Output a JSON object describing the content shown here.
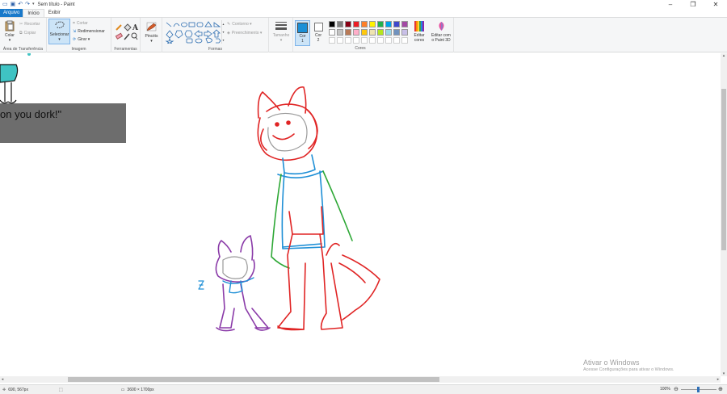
{
  "window": {
    "title": "Sem título - Paint",
    "qa_icons": [
      "paint-app-icon",
      "save-icon",
      "undo-icon",
      "redo-icon",
      "customize-icon"
    ]
  },
  "tabs": [
    {
      "label": "Arquivo"
    },
    {
      "label": "Início"
    },
    {
      "label": "Exibir"
    }
  ],
  "ribbon": {
    "clipboard": {
      "label": "Área de Transferência",
      "paste": "Colar",
      "cut": "Recortar",
      "copy": "Copiar"
    },
    "image": {
      "label": "Imagem",
      "select": "Selecionar",
      "crop": "Cortar",
      "resize": "Redimensionar",
      "rotate": "Girar ▾"
    },
    "tools": {
      "label": "Ferramentas"
    },
    "brushes": {
      "label": "Pincéis"
    },
    "shapes": {
      "label": "Formas",
      "outline": "Contorno ▾",
      "fill": "Preenchimento ▾"
    },
    "size": {
      "label": "Tamanho"
    },
    "color1": {
      "label": "Cor",
      "num": "1"
    },
    "color2": {
      "label": "Cor",
      "num": "2"
    },
    "colors": {
      "label": "Cores",
      "row1": [
        "#000000",
        "#7f7f7f",
        "#880015",
        "#ed1c24",
        "#ff7f27",
        "#fff200",
        "#22b14c",
        "#00a2e8",
        "#3f48cc",
        "#a349a4"
      ],
      "row2": [
        "#ffffff",
        "#c3c3c3",
        "#b97a57",
        "#ffaec9",
        "#ffc90e",
        "#efe4b0",
        "#b5e61d",
        "#99d9ea",
        "#7092be",
        "#c8bfe7"
      ]
    },
    "edit_colors": {
      "line1": "Editar",
      "line2": "cores"
    },
    "paint3d": {
      "line1": "Editar com",
      "line2": "o Paint 3D"
    }
  },
  "canvas": {
    "pasted_text": "on you dork!\""
  },
  "watermark": {
    "line1": "Ativar o Windows",
    "line2": "Acesse Configurações para ativar o Windows."
  },
  "status": {
    "cursor": "690, 567px",
    "size": "3600 × 1700px",
    "zoom": "100%"
  }
}
